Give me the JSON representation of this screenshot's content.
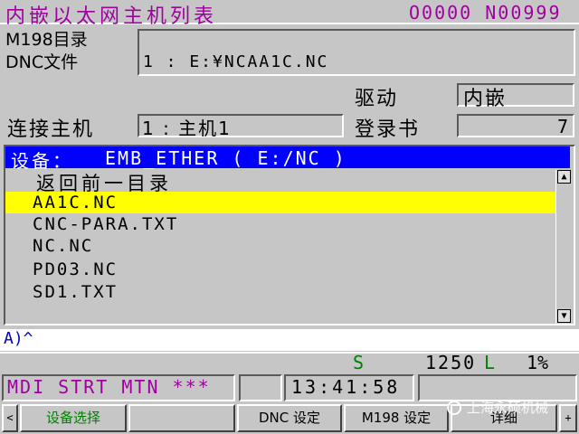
{
  "title": "内嵌以太网主机列表",
  "program_number": "O0000 N00999",
  "directory": {
    "label_line1": "M198目录",
    "label_line2": "DNC文件",
    "dnc_file": "1 : E:¥NCAA1C.NC"
  },
  "drive": {
    "label": "驱动",
    "value": "内嵌"
  },
  "connect": {
    "label": "连接主机",
    "value": "1 : 主机1"
  },
  "login": {
    "label": "登录书",
    "value": "7"
  },
  "list": {
    "header_cn": "设备：",
    "header_device": "EMB_ETHER   ( E:/NC )",
    "up_dir": "返回前一目录",
    "files": [
      "AA1C.NC",
      "CNC-PARA.TXT",
      "NC.NC",
      "PD03.NC",
      "SD1.TXT"
    ],
    "selected_index": 0
  },
  "input_line": "A)^",
  "status": {
    "s_label": "S",
    "spindle": "1250",
    "l_label": "L",
    "override": "1%"
  },
  "mode": {
    "text": "MDI STRT MTN ***",
    "time": "13:41:58"
  },
  "softkeys": {
    "left_arrow": "<",
    "k1": "设备选择",
    "k2": "",
    "k3": "DNC 设定",
    "k4": "M198 设定",
    "k5": "详细",
    "right_arrow": "+"
  },
  "watermark": "上海永硕机械",
  "colors": {
    "title": "#a000a0",
    "header_bg": "#0000ff",
    "selected_bg": "#ffff00",
    "status_green": "#008000"
  }
}
